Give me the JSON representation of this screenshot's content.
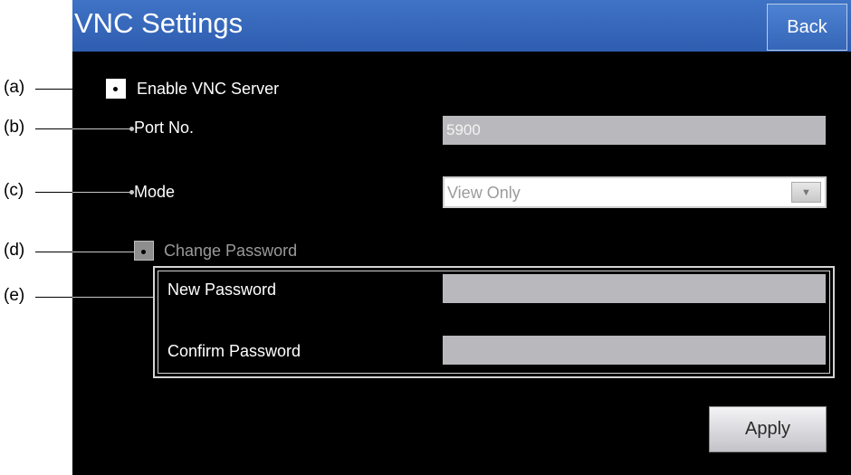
{
  "header": {
    "title": "VNC Settings",
    "back_label": "Back"
  },
  "callouts": [
    "(a)",
    "(b)",
    "(c)",
    "(d)",
    "(e)"
  ],
  "form": {
    "enable_vnc_label": "Enable VNC Server",
    "port_label": "Port No.",
    "port_value": "5900",
    "mode_label": "Mode",
    "mode_selected": "View Only",
    "change_password_label": "Change Password",
    "new_password_label": "New Password",
    "new_password_value": "",
    "confirm_password_label": "Confirm Password",
    "confirm_password_value": ""
  },
  "actions": {
    "apply_label": "Apply"
  },
  "colors": {
    "titlebar": "#3a6cc0",
    "screen_background": "#000000",
    "disabled_field": "#b9b9bd"
  }
}
